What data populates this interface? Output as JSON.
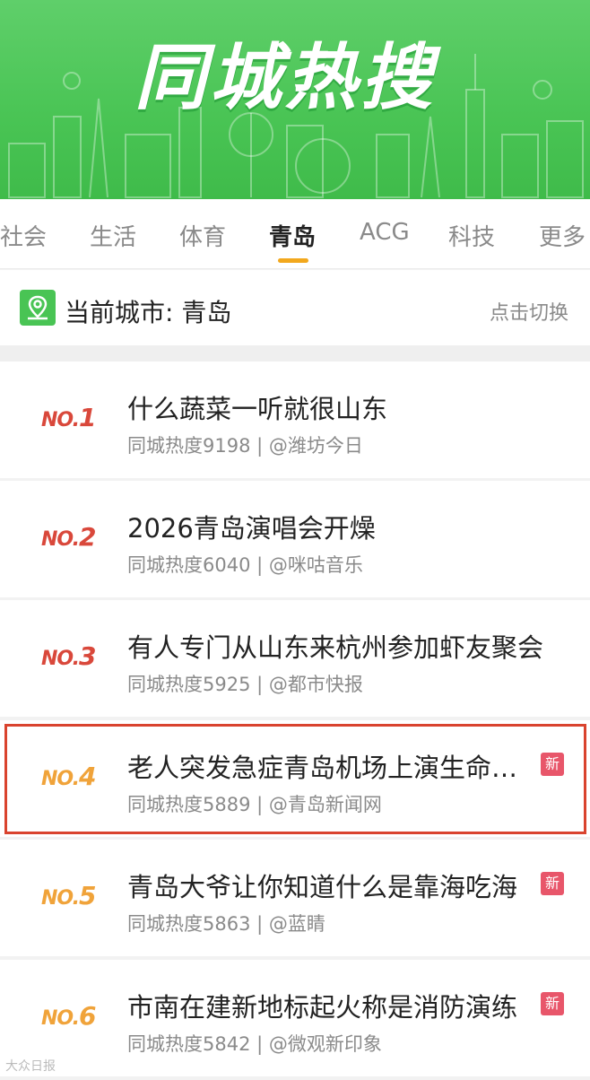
{
  "banner": {
    "title": "同城热搜"
  },
  "tabs": [
    {
      "label": "社会"
    },
    {
      "label": "生活"
    },
    {
      "label": "体育"
    },
    {
      "label": "青岛",
      "active": true
    },
    {
      "label": "ACG"
    },
    {
      "label": "科技"
    },
    {
      "label": "更多"
    }
  ],
  "city": {
    "current": "当前城市: 青岛",
    "switch_label": "点击切换"
  },
  "badge_label": "新",
  "items": [
    {
      "rank": "1",
      "title": "什么蔬菜一听就很山东",
      "meta": "同城热度9198 | @潍坊今日",
      "new": false
    },
    {
      "rank": "2",
      "title": "2026青岛演唱会开燥",
      "meta": "同城热度6040 | @咪咕音乐",
      "new": false
    },
    {
      "rank": "3",
      "title": "有人专门从山东来杭州参加虾友聚会",
      "meta": "同城热度5925 | @都市快报",
      "new": false
    },
    {
      "rank": "4",
      "title": "老人突发急症青岛机场上演生命…",
      "meta": "同城热度5889 | @青岛新闻网",
      "new": true,
      "highlighted": true
    },
    {
      "rank": "5",
      "title": "青岛大爷让你知道什么是靠海吃海",
      "meta": "同城热度5863 | @蓝睛",
      "new": true
    },
    {
      "rank": "6",
      "title": "市南在建新地标起火称是消防演练",
      "meta": "同城热度5842 | @微观新印象",
      "new": true
    }
  ],
  "rank_prefix": "NO.",
  "colors": {
    "banner": "#49c454",
    "accent": "#f2a81d",
    "rank_top": "#d9483b",
    "rank_other": "#f0a33a",
    "badge": "#e8566a",
    "highlight": "#d9432e"
  },
  "watermark": "大众日报"
}
